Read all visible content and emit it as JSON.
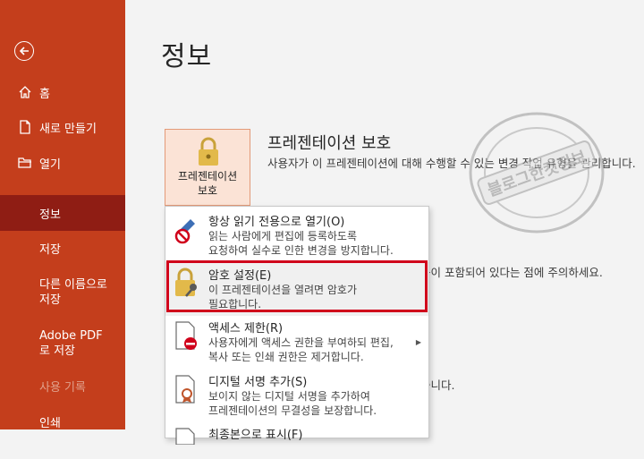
{
  "sidebar": {
    "items": [
      {
        "label": "홈",
        "icon": "home-icon"
      },
      {
        "label": "새로 만들기",
        "icon": "new-file-icon"
      },
      {
        "label": "열기",
        "icon": "folder-icon"
      },
      {
        "label": "정보"
      },
      {
        "label": "저장"
      },
      {
        "label": "다른 이름으로 저장"
      },
      {
        "label": "Adobe PDF로 저장"
      },
      {
        "label": "사용 기록"
      },
      {
        "label": "인쇄"
      }
    ]
  },
  "main": {
    "title": "정보",
    "protect": {
      "button_label": "프레젠테이션 보호",
      "title": "프레젠테이션 보호",
      "description": "사용자가 이 프레젠테이션에 대해 수행할 수 있는 변경 작업 유형을 관리합니다."
    },
    "background_text": {
      "line1": "용이 포함되어 있다는 점에 주의하세요.",
      "line2": "습니다."
    }
  },
  "menu": {
    "items": [
      {
        "title": "항상 읽기 전용으로 열기(O)",
        "desc1": "읽는 사람에게 편집에 등록하도록",
        "desc2": "요청하여 실수로 인한 변경을 방지합니다."
      },
      {
        "title": "암호 설정(E)",
        "desc1": "이 프레젠테이션을 열려면 암호가",
        "desc2": "필요합니다."
      },
      {
        "title": "액세스 제한(R)",
        "desc1": "사용자에게 액세스 권한을 부여하되 편집,",
        "desc2": "복사 또는 인쇄 권한은 제거합니다."
      },
      {
        "title": "디지털 서명 추가(S)",
        "desc1": "보이지 않는 디지털 서명을 추가하여",
        "desc2": "프레젠테이션의 무결성을 보장합니다."
      },
      {
        "title": "최종본으로 표시(F)"
      }
    ]
  },
  "watermark": {
    "text": "블로그한컷정보"
  },
  "colors": {
    "sidebar": "#c43e1c",
    "sidebar_active": "#8f1d14",
    "highlight": "#d0021b",
    "protect_button_bg": "#fbe3d6"
  }
}
